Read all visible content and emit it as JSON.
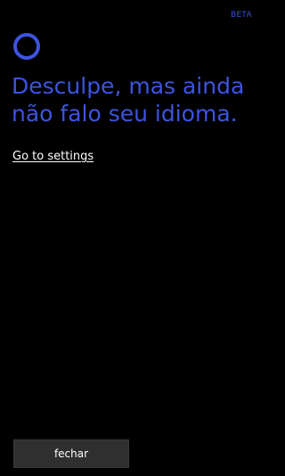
{
  "header": {
    "badge": "BETA",
    "badge_color": "#3b4fd9"
  },
  "assistant": {
    "icon": "cortana-ring-icon",
    "accent_color": "#3d54e0"
  },
  "message": {
    "line1": "Desculpe, mas ainda",
    "line2": "não falo seu idioma."
  },
  "link": {
    "label": "Go to settings"
  },
  "footer": {
    "close_label": "fechar"
  }
}
